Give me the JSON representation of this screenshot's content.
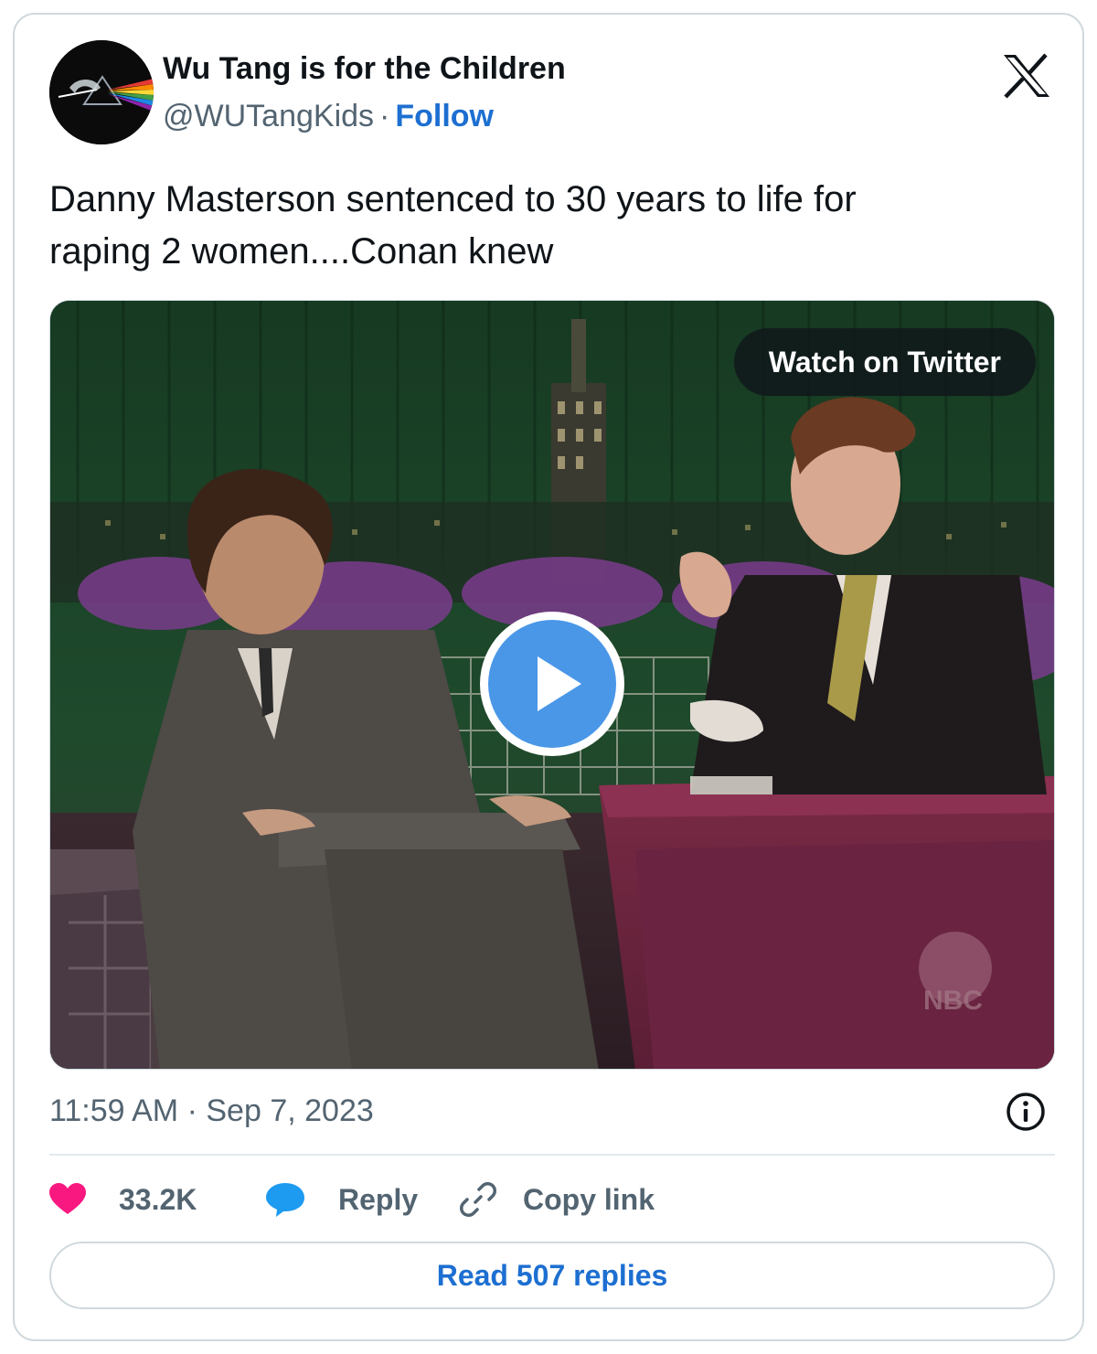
{
  "tweet": {
    "author": {
      "display_name": "Wu Tang is for the Children",
      "handle": "@WUTangKids",
      "separator": "·",
      "follow_label": "Follow",
      "avatar_icon": "wu-tang-prism-avatar"
    },
    "platform_icon": "x-logo-icon",
    "text_lines": [
      "Danny Masterson sentenced to 30 years to life for",
      "raping 2 women....Conan knew"
    ],
    "media": {
      "type": "video",
      "watch_label": "Watch on Twitter",
      "play_icon": "play-icon",
      "thumbnail_watermark": "NBC"
    },
    "timestamp": {
      "time": "11:59 AM",
      "separator": "·",
      "date": "Sep 7, 2023"
    },
    "info_icon": "info-icon",
    "actions": {
      "like": {
        "icon": "heart-icon",
        "label": "33.2K"
      },
      "reply": {
        "icon": "speech-bubble-icon",
        "label": "Reply"
      },
      "copy": {
        "icon": "link-icon",
        "label": "Copy link"
      }
    },
    "read_replies_label": "Read 507 replies",
    "colors": {
      "follow_blue": "#1d6fd1",
      "like_pink": "#f91880",
      "reply_blue": "#1d9bf0",
      "muted_text": "#536471",
      "border": "#cfd9de",
      "play_blue": "#4a97e8"
    }
  }
}
